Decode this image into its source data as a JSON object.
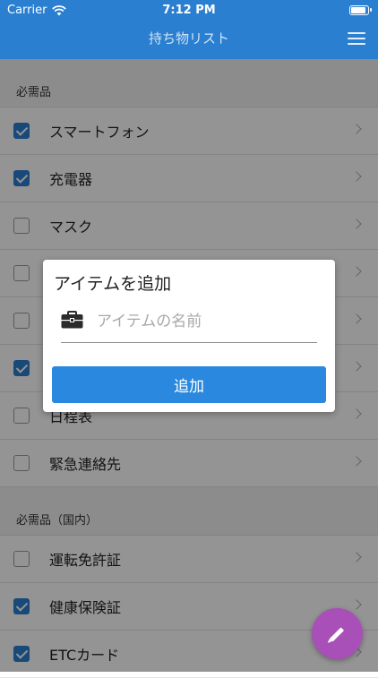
{
  "status_bar": {
    "carrier": "Carrier",
    "time": "7:12 PM",
    "battery_fill": 0.95
  },
  "nav": {
    "title": "持ち物リスト",
    "menu_icon": "hamburger-menu-icon"
  },
  "sections": [
    {
      "header": "必需品",
      "items": [
        {
          "label": "スマートフォン",
          "checked": true
        },
        {
          "label": "充電器",
          "checked": true
        },
        {
          "label": "マスク",
          "checked": false
        },
        {
          "label": "",
          "checked": false
        },
        {
          "label": "",
          "checked": false
        },
        {
          "label": "",
          "checked": true
        },
        {
          "label": "日程表",
          "checked": false
        },
        {
          "label": "緊急連絡先",
          "checked": false
        }
      ]
    },
    {
      "header": "必需品（国内）",
      "items": [
        {
          "label": "運転免許証",
          "checked": false
        },
        {
          "label": "健康保険証",
          "checked": true
        },
        {
          "label": "ETCカード",
          "checked": true
        }
      ]
    }
  ],
  "dialog": {
    "title": "アイテムを追加",
    "input_icon": "briefcase-icon",
    "input_placeholder": "アイテムの名前",
    "input_value": "",
    "add_button": "追加"
  },
  "fab": {
    "icon": "pencil-icon"
  },
  "colors": {
    "primary": "#2a7fd0",
    "fab": "#a94fb8",
    "button": "#2a88de"
  }
}
